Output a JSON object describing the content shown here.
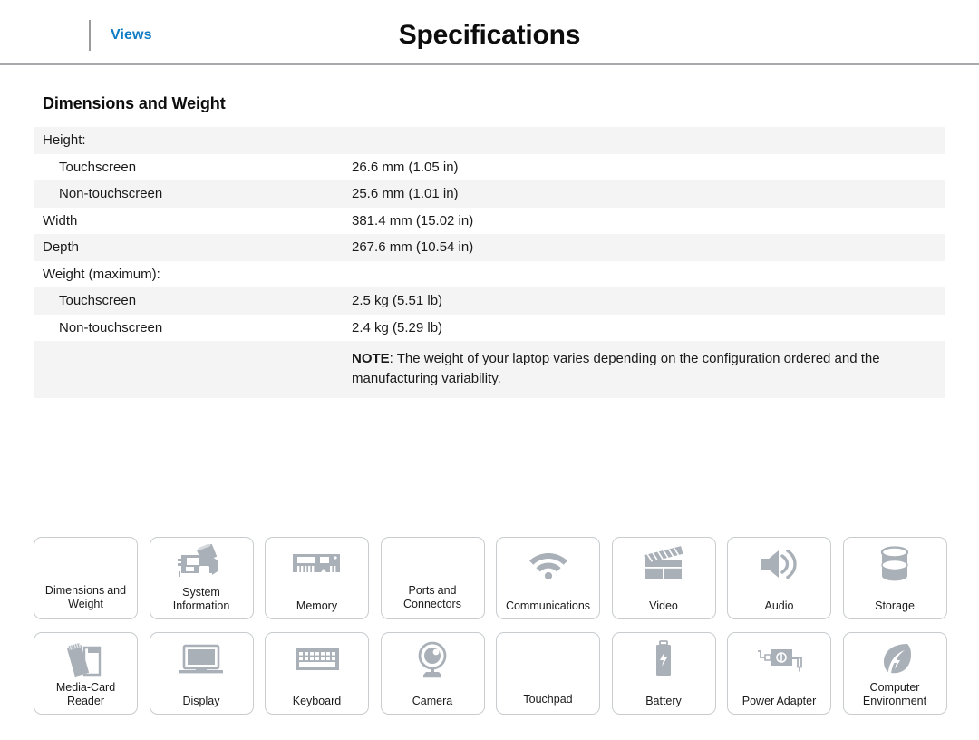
{
  "header": {
    "views_label": "Views",
    "title": "Specifications",
    "link_color": "#0f7dc4",
    "rule_color": "#a7a9ac"
  },
  "section": {
    "heading": "Dimensions and Weight"
  },
  "spec_table": {
    "rows": [
      {
        "label": "Height:",
        "value": "",
        "indent": false,
        "shaded": true
      },
      {
        "label": "Touchscreen",
        "value": "26.6 mm (1.05 in)",
        "indent": true,
        "shaded": false
      },
      {
        "label": "Non-touchscreen",
        "value": "25.6 mm (1.01 in)",
        "indent": true,
        "shaded": true
      },
      {
        "label": "Width",
        "value": "381.4 mm (15.02 in)",
        "indent": false,
        "shaded": false
      },
      {
        "label": "Depth",
        "value": "267.6 mm (10.54 in)",
        "indent": false,
        "shaded": true
      },
      {
        "label": "Weight (maximum):",
        "value": "",
        "indent": false,
        "shaded": false
      },
      {
        "label": "Touchscreen",
        "value": "2.5 kg (5.51 lb)",
        "indent": true,
        "shaded": true
      },
      {
        "label": "Non-touchscreen",
        "value": "2.4 kg (5.29 lb)",
        "indent": true,
        "shaded": false
      }
    ],
    "note": {
      "prefix": "NOTE",
      "text": ": The weight of your laptop varies depending on the configuration ordered and the manufacturing variability."
    }
  },
  "tiles": [
    {
      "label": "Dimensions and Weight",
      "icon": "none",
      "active": true
    },
    {
      "label": "System Information",
      "icon": "system-board-icon",
      "active": false
    },
    {
      "label": "Memory",
      "icon": "memory-module-icon",
      "active": false
    },
    {
      "label": "Ports and Connectors",
      "icon": "none",
      "active": false
    },
    {
      "label": "Communications",
      "icon": "wifi-icon",
      "active": false
    },
    {
      "label": "Video",
      "icon": "clapperboard-icon",
      "active": false
    },
    {
      "label": "Audio",
      "icon": "speaker-icon",
      "active": false
    },
    {
      "label": "Storage",
      "icon": "disk-cylinder-icon",
      "active": false
    },
    {
      "label": "Media-Card Reader",
      "icon": "media-card-icon",
      "active": false
    },
    {
      "label": "Display",
      "icon": "laptop-display-icon",
      "active": false
    },
    {
      "label": "Keyboard",
      "icon": "keyboard-icon",
      "active": false
    },
    {
      "label": "Camera",
      "icon": "webcam-icon",
      "active": false
    },
    {
      "label": "Touchpad",
      "icon": "none",
      "active": false
    },
    {
      "label": "Battery",
      "icon": "battery-icon",
      "active": false
    },
    {
      "label": "Power Adapter",
      "icon": "power-adapter-icon",
      "active": false
    },
    {
      "label": "Computer Environment",
      "icon": "leaf-icon",
      "active": false
    }
  ],
  "colors": {
    "icon_gray": "#a9b0b8",
    "tile_border": "#c8ccce",
    "row_shade": "#f4f4f5"
  }
}
